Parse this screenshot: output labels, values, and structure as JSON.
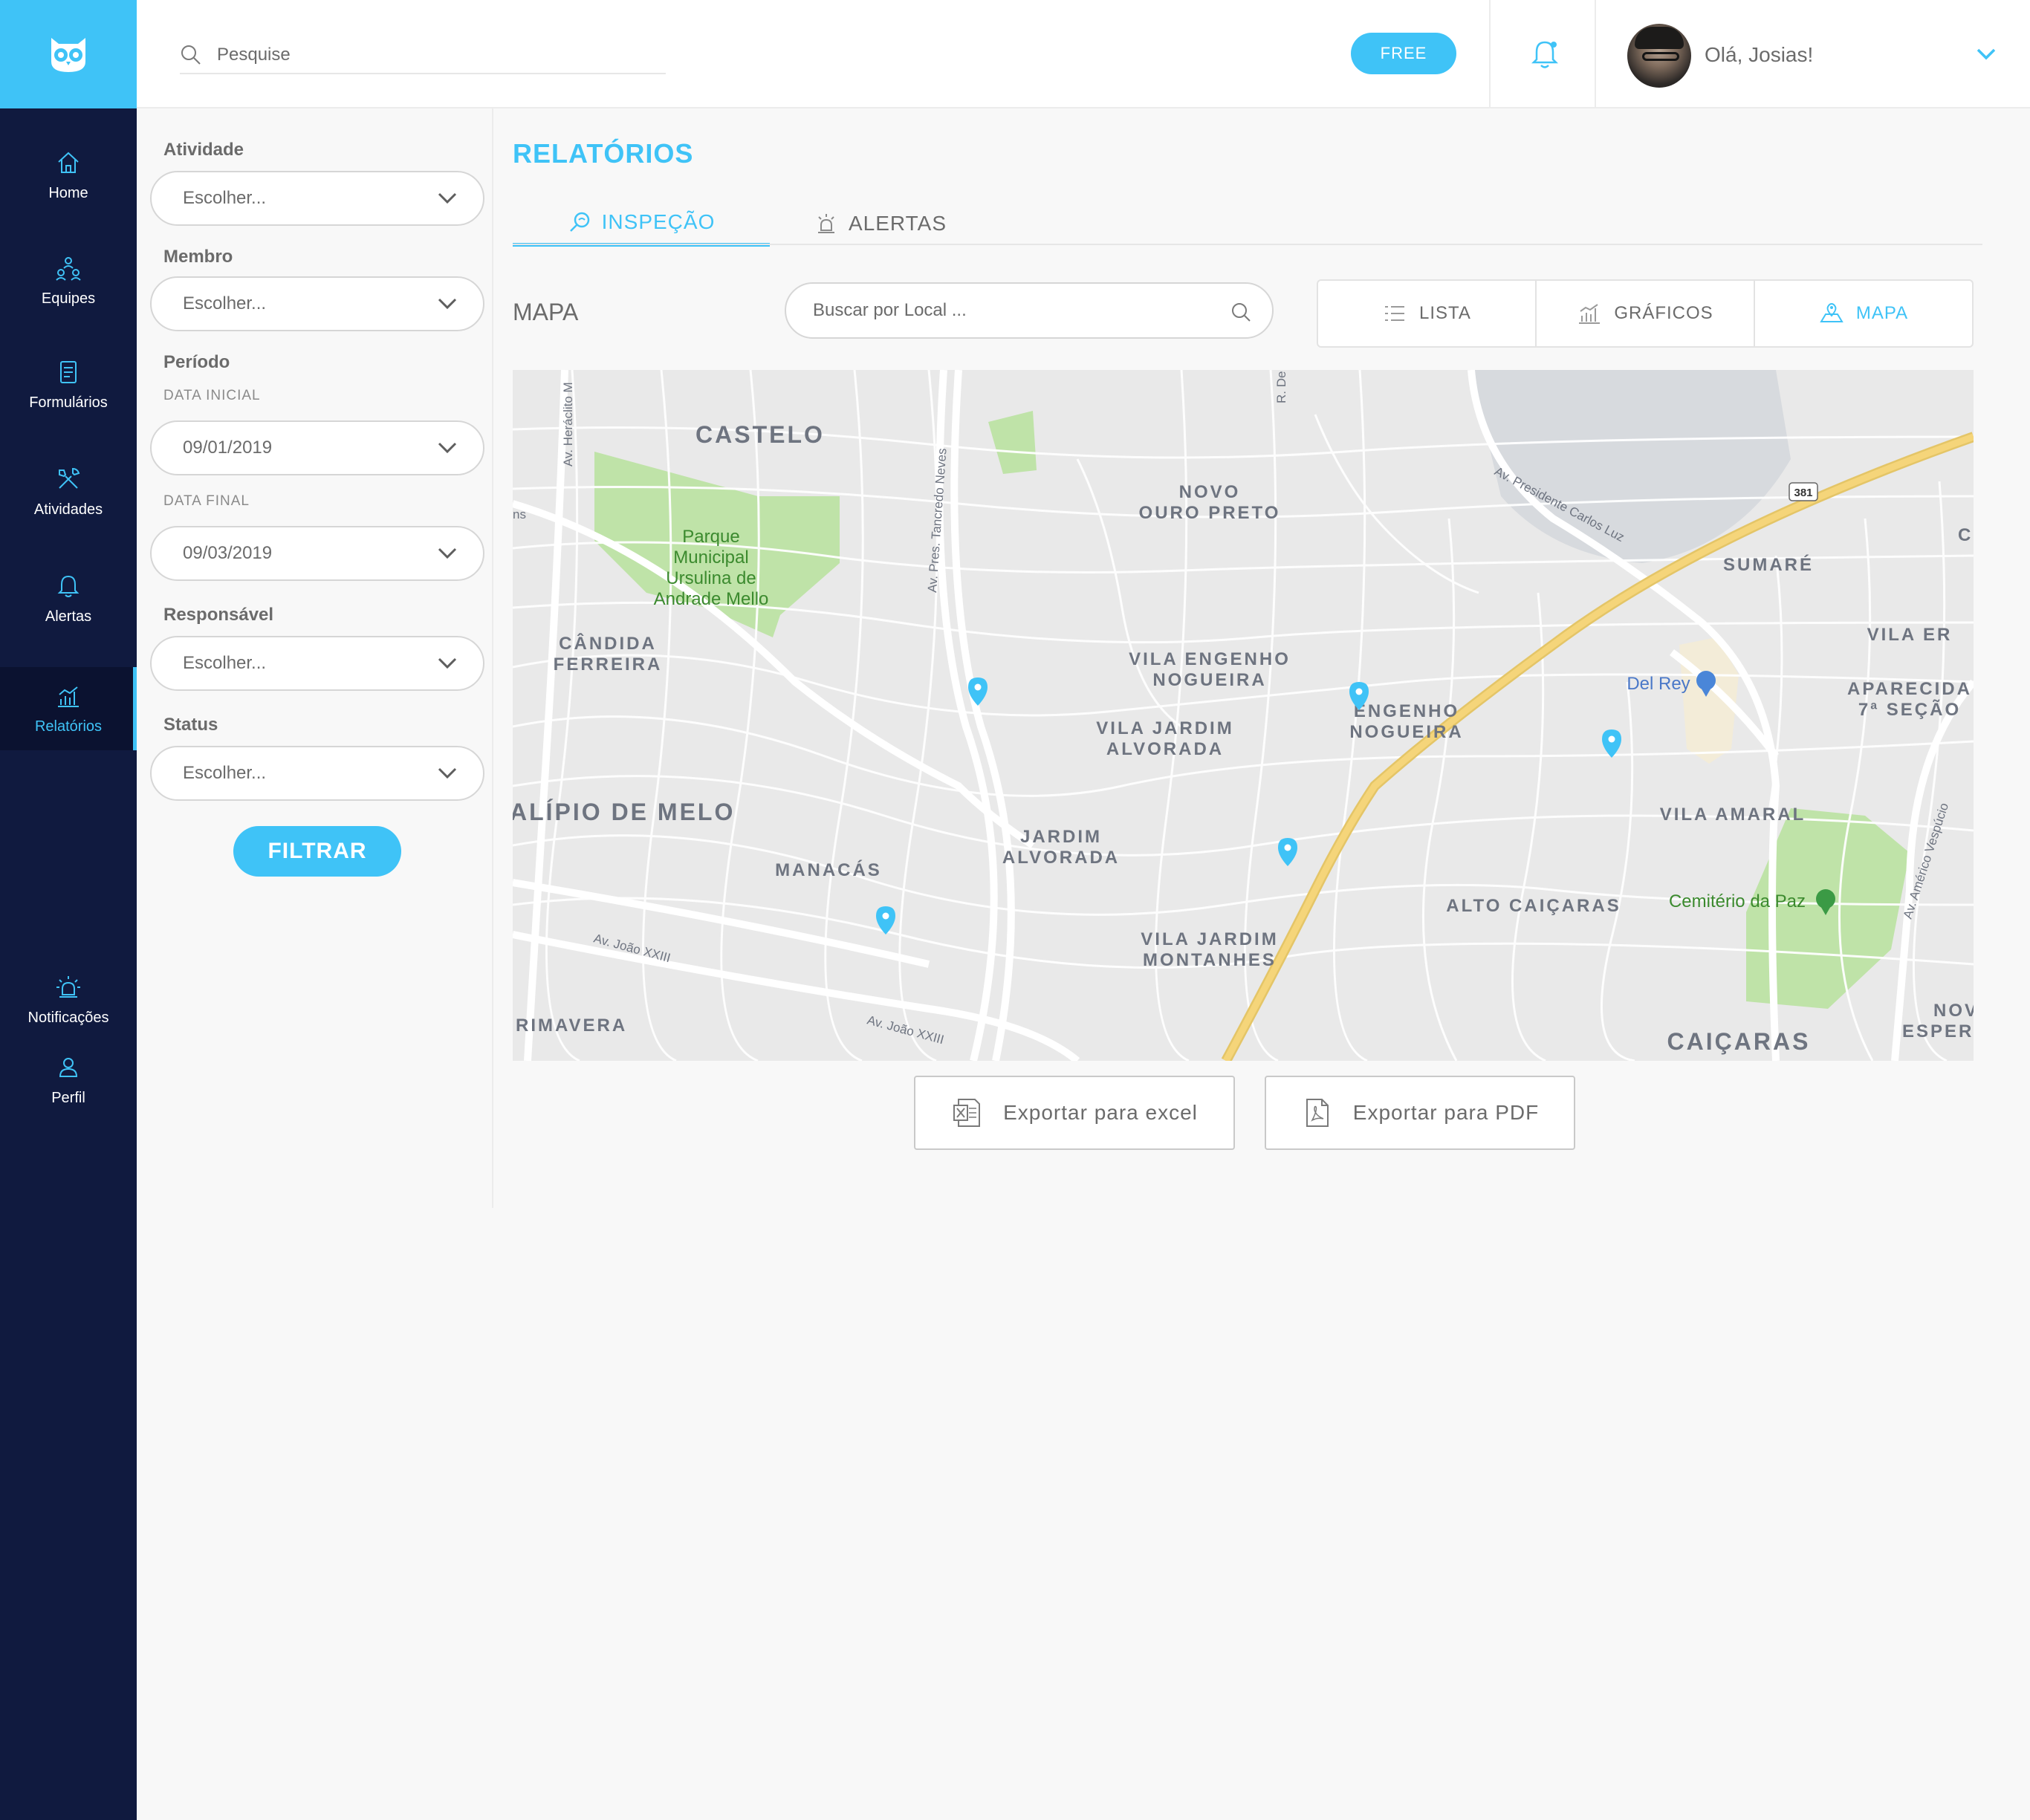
{
  "header": {
    "search_placeholder": "Pesquise",
    "plan_badge": "FREE",
    "greeting": "Olá, Josias!"
  },
  "sidebar": {
    "items": [
      {
        "label": "Home",
        "icon": "home-icon"
      },
      {
        "label": "Equipes",
        "icon": "teams-icon"
      },
      {
        "label": "Formulários",
        "icon": "form-icon"
      },
      {
        "label": "Atividades",
        "icon": "tools-icon"
      },
      {
        "label": "Alertas",
        "icon": "bell-icon"
      },
      {
        "label": "Relatórios",
        "icon": "chart-icon",
        "active": true
      },
      {
        "label": "Notificações",
        "icon": "siren-icon"
      },
      {
        "label": "Perfil",
        "icon": "user-icon"
      }
    ]
  },
  "filters": {
    "atividade": {
      "label": "Atividade",
      "value": "Escolher..."
    },
    "membro": {
      "label": "Membro",
      "value": "Escolher..."
    },
    "periodo": {
      "label": "Período",
      "data_inicial_label": "DATA INICIAL",
      "data_inicial": "09/01/2019",
      "data_final_label": "DATA FINAL",
      "data_final": "09/03/2019"
    },
    "responsavel": {
      "label": "Responsável",
      "value": "Escolher..."
    },
    "status": {
      "label": "Status",
      "value": "Escolher..."
    },
    "submit": "FILTRAR"
  },
  "main": {
    "title": "RELATÓRIOS",
    "tabs": [
      {
        "label": "INSPEÇÃO",
        "active": true
      },
      {
        "label": "ALERTAS",
        "active": false
      }
    ],
    "section_label": "MAPA",
    "location_search_placeholder": "Buscar por Local ...",
    "views": [
      {
        "label": "LISTA"
      },
      {
        "label": "GRÁFICOS"
      },
      {
        "label": "MAPA",
        "active": true
      }
    ],
    "export_excel": "Exportar para excel",
    "export_pdf": "Exportar para PDF"
  },
  "map": {
    "neighborhoods": {
      "castelo": "CASTELO",
      "novo_ouro_preto_1": "NOVO",
      "novo_ouro_preto_2": "OURO PRETO",
      "sumare": "SUMARÉ",
      "candida_ferreira_1": "CÂNDIDA",
      "candida_ferreira_2": "FERREIRA",
      "vila_engenho_1": "VILA ENGENHO",
      "vila_engenho_2": "NOGUEIRA",
      "engenho_1": "ENGENHO",
      "engenho_2": "NOGUEIRA",
      "vila_jardim_alvorada_1": "VILA JARDIM",
      "vila_jardim_alvorada_2": "ALVORADA",
      "aparecida_1": "APARECIDA",
      "aparecida_2": "7ª SEÇÃO",
      "vila_er": "VILA ER",
      "alipio": "ALÍPIO DE MELO",
      "jardim_alvorada_1": "JARDIM",
      "jardim_alvorada_2": "ALVORADA",
      "vila_amaral": "VILA AMARAL",
      "manacas": "MANACÁS",
      "alto_caicaras": "ALTO CAIÇARAS",
      "vila_jardim_montanhes_1": "VILA JARDIM",
      "vila_jardim_montanhes_2": "MONTANHES",
      "rimavera": "RIMAVERA",
      "caicaras": "CAIÇARAS",
      "nov": "NOV",
      "espera": "ESPERA",
      "c": "C."
    },
    "parks": {
      "parque_1": "Parque",
      "parque_2": "Municipal",
      "parque_3": "Ursulina de",
      "parque_4": "Andrade Mello",
      "cemiterio": "Cemitério da Paz",
      "del_rey": "Del Rey"
    },
    "streets": {
      "heraclito": "Av. Heráclito M",
      "tancredo": "Av. Pres. Tancredo Neves",
      "r_de": "R. De",
      "carlos_luz": "Av. Presidente Carlos Luz",
      "joao_xxiii_1": "Av. João XXIII",
      "joao_xxiii_2": "Av. João XXIII",
      "americo": "Av. Américo Vespúcio",
      "ns": "ns",
      "route": "381"
    },
    "colors": {
      "road_major": "#f5d57a",
      "park": "#bfe3a8",
      "water": "#d7dade",
      "marker": "#3fc3f7"
    }
  }
}
